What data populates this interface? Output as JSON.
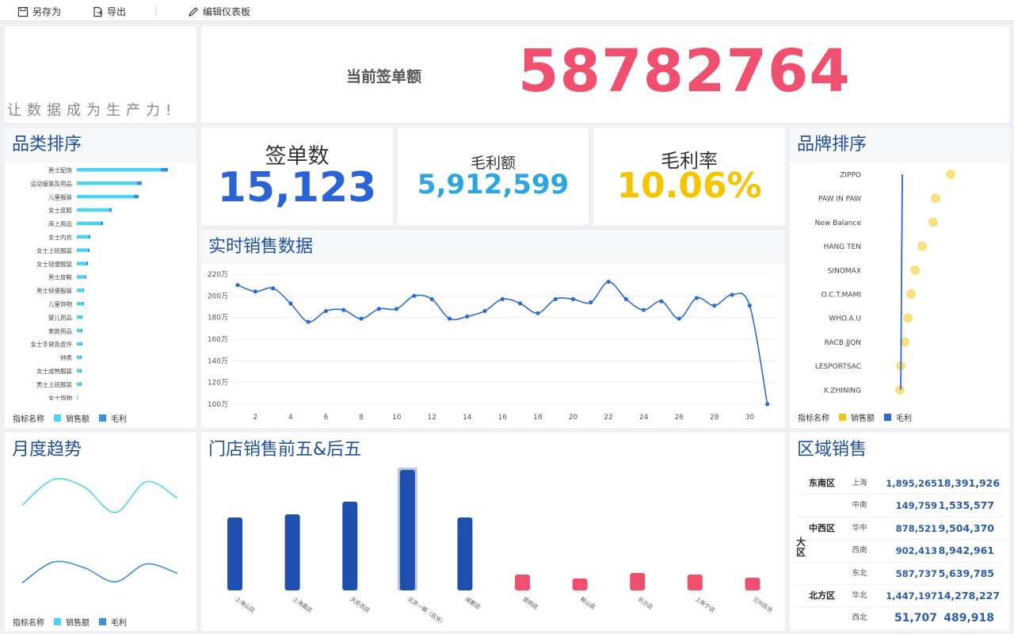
{
  "toolbar": {
    "save_as": "另存为",
    "export": "导出",
    "edit": "编辑仪表板"
  },
  "slogan": "让数据成为生产力!",
  "current_sign": {
    "label": "当前签单额",
    "value": "58782764"
  },
  "kpis": {
    "count": {
      "label": "签单数",
      "value": "15,123"
    },
    "profit": {
      "label": "毛利额",
      "value": "5,912,599"
    },
    "rate": {
      "label": "毛利率",
      "value": "10.06%"
    }
  },
  "colors": {
    "sales": "#4fd3f2",
    "profit": "#3a8ee6",
    "brand_sales": "#f5c518",
    "brand_profit": "#2f6bd6",
    "big_red": "#f0506e",
    "kpi_blue": "#2a63d6",
    "kpi_cyan": "#2aa6e3",
    "kpi_yellow": "#f6c500"
  },
  "category_rank": {
    "title": "品类排序",
    "legend_title": "指标名称",
    "legend": [
      "销售额",
      "毛利"
    ],
    "chart_data": {
      "type": "bar",
      "categories": [
        "男士配饰",
        "运动服装及用品",
        "儿童服装",
        "女士皮鞋",
        "床上用品",
        "女士内衣",
        "女士上班服装",
        "女士轻便服装",
        "男士皮鞋",
        "男士轻便服装",
        "儿童饰物",
        "婴儿用品",
        "家庭用品",
        "女士手袋及皮件",
        "钟表",
        "女士成熟服装",
        "男士上班服装",
        "女士饰物"
      ],
      "series": [
        {
          "name": "销售额",
          "values": [
            106,
            76,
            72,
            41,
            30,
            15,
            14,
            12,
            11,
            8,
            8,
            6,
            6,
            6,
            5,
            5,
            5,
            1
          ]
        },
        {
          "name": "毛利",
          "values": [
            9,
            6,
            6,
            3,
            3,
            2,
            2,
            2,
            1,
            1,
            1,
            1,
            1,
            1,
            1,
            1,
            1,
            0.3
          ]
        }
      ]
    }
  },
  "realtime": {
    "title": "实时销售数据",
    "chart_data": {
      "type": "line",
      "x": [
        1,
        2,
        3,
        4,
        5,
        6,
        7,
        8,
        9,
        10,
        11,
        12,
        13,
        14,
        15,
        16,
        17,
        18,
        19,
        20,
        21,
        22,
        23,
        24,
        25,
        26,
        27,
        28,
        29,
        30,
        31
      ],
      "y_ticks": [
        "100万",
        "120万",
        "140万",
        "160万",
        "180万",
        "200万",
        "220万"
      ],
      "x_ticks": [
        "2",
        "4",
        "6",
        "8",
        "10",
        "12",
        "14",
        "16",
        "18",
        "20",
        "22",
        "24",
        "26",
        "28",
        "30"
      ],
      "ylim": [
        100,
        220
      ],
      "series": [
        {
          "values": [
            210,
            204,
            207,
            193,
            176,
            186,
            187,
            179,
            188,
            188,
            200,
            197,
            179,
            181,
            186,
            197,
            193,
            184,
            197,
            197,
            194,
            213,
            197,
            187,
            195,
            179,
            198,
            191,
            201,
            191,
            100
          ]
        }
      ]
    }
  },
  "brand_rank": {
    "title": "品牌排序",
    "legend_title": "指标名称",
    "legend": [
      "销售额",
      "毛利"
    ],
    "chart_data": {
      "type": "scatter",
      "categories": [
        "ZIPPO",
        "PAW IN PAW",
        "New Balance",
        "HANG TEN",
        "SINOMAX",
        "O.C.T.MAMI",
        "WHO.A.U",
        "RACB JJQN",
        "LESPORTSAC",
        "X.ZHINING"
      ],
      "series": [
        {
          "name": "销售额",
          "values": [
            65,
            46,
            43,
            29,
            20,
            15,
            11,
            7,
            2,
            1
          ]
        },
        {
          "name": "毛利",
          "values": [
            4,
            3.8,
            3.6,
            3.3,
            3.1,
            2.9,
            2.7,
            2.5,
            2.3,
            2
          ]
        }
      ]
    }
  },
  "monthly": {
    "title": "月度趋势",
    "legend_title": "指标名称",
    "legend": [
      "销售额",
      "毛利"
    ],
    "chart_data": {
      "type": "line",
      "series": [
        {
          "name": "销售额",
          "values": [
            0.28,
            0.9,
            0.72,
            0.1,
            0.85,
            0.45
          ]
        },
        {
          "name": "毛利",
          "values": [
            0.05,
            0.6,
            0.45,
            0.08,
            0.55,
            0.3
          ]
        }
      ]
    }
  },
  "store": {
    "title": "门店销售前五&后五",
    "chart_data": {
      "type": "bar",
      "categories": [
        "上海山店",
        "上海嘉店",
        "天府百店",
        "北京一期（百货）",
        "成都店",
        "昆明店",
        "鞍山店",
        "长沙店",
        "上新宁店",
        "兰州百货"
      ],
      "values": [
        92,
        96,
        112,
        152,
        92,
        20,
        15,
        22,
        20,
        16
      ]
    }
  },
  "region": {
    "title": "区域销售",
    "big_region": "大区",
    "rows": [
      {
        "area": "东南区",
        "sub": "上海",
        "v1": "1,895,265",
        "v2": "18,391,926"
      },
      {
        "area": "",
        "sub": "中南",
        "v1": "149,759",
        "v2": "1,535,577"
      },
      {
        "area": "中西区",
        "sub": "华中",
        "v1": "878,521",
        "v2": "9,504,370"
      },
      {
        "area": "",
        "sub": "西南",
        "v1": "902,413",
        "v2": "8,942,961"
      },
      {
        "area": "",
        "sub": "东北",
        "v1": "587,737",
        "v2": "5,639,785"
      },
      {
        "area": "北方区",
        "sub": "华北",
        "v1": "1,447,197",
        "v2": "14,278,227"
      },
      {
        "area": "",
        "sub": "西北",
        "v1": "51,707",
        "v2": "489,918"
      }
    ]
  }
}
